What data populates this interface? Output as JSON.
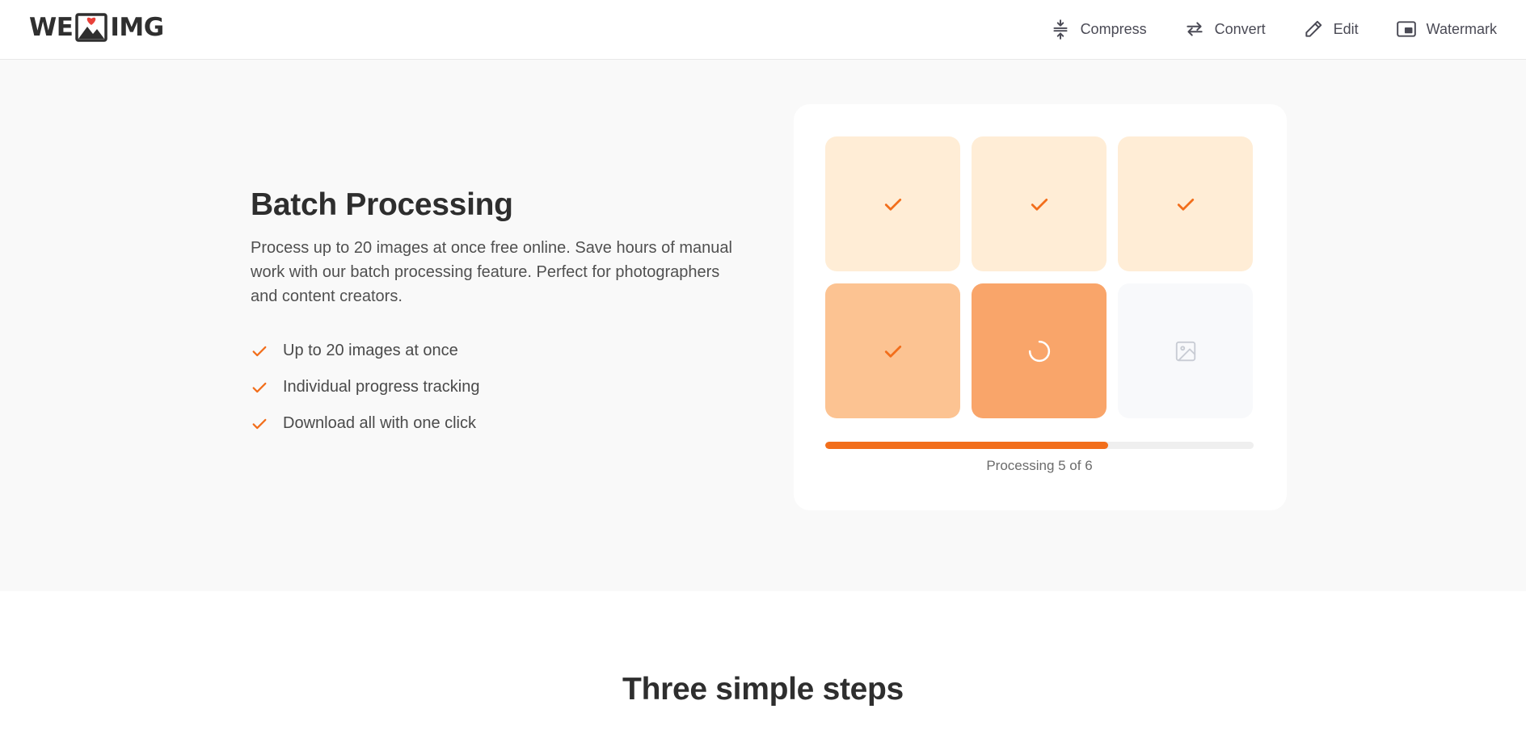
{
  "brand": {
    "left": "WE",
    "right": "IMG",
    "accent": "#f26e1b",
    "heart": "#e8413a"
  },
  "nav": [
    {
      "label": "Compress",
      "icon": "compress-icon"
    },
    {
      "label": "Convert",
      "icon": "convert-icon"
    },
    {
      "label": "Edit",
      "icon": "pencil-icon"
    },
    {
      "label": "Watermark",
      "icon": "watermark-icon"
    }
  ],
  "feature": {
    "title": "Batch Processing",
    "description": "Process up to 20 images at once free online. Save hours of manual work with our batch processing feature. Perfect for photographers and content creators.",
    "bullets": [
      "Up to 20 images at once",
      "Individual progress tracking",
      "Download all with one click"
    ]
  },
  "batch": {
    "tiles": [
      {
        "status": "done",
        "icon": "check-icon",
        "color": "#ffedd6"
      },
      {
        "status": "done",
        "icon": "check-icon",
        "color": "#ffedd6"
      },
      {
        "status": "done",
        "icon": "check-icon",
        "color": "#ffedd6"
      },
      {
        "status": "done",
        "icon": "check-icon",
        "color": "#fcc392"
      },
      {
        "status": "processing",
        "icon": "spinner-icon",
        "color": "#f9a56a"
      },
      {
        "status": "pending",
        "icon": "image-icon",
        "color": "#f8f9fb"
      }
    ],
    "progress_fraction": 0.66,
    "progress_text": "Processing 5 of 6"
  },
  "steps": {
    "title": "Three simple steps"
  }
}
